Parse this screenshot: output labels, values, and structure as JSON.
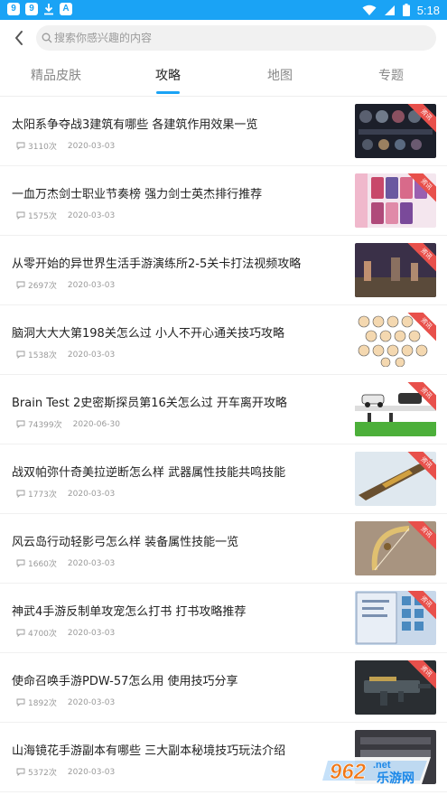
{
  "status_bar": {
    "time": "5:18",
    "left_icons": [
      "app-icon-1",
      "app-icon-2",
      "download-icon",
      "a-icon"
    ],
    "right_icons": [
      "wifi-icon",
      "signal-icon",
      "battery-icon"
    ]
  },
  "search": {
    "placeholder": "搜索你感兴趣的内容"
  },
  "tabs": [
    {
      "label": "精品皮肤",
      "active": false
    },
    {
      "label": "攻略",
      "active": true
    },
    {
      "label": "地图",
      "active": false
    },
    {
      "label": "专题",
      "active": false
    }
  ],
  "articles": [
    {
      "title": "太阳系争夺战3建筑有哪些 各建筑作用效果一览",
      "count": "3110次",
      "date": "2020-03-03",
      "badge": "资讯"
    },
    {
      "title": "一血万杰剑士职业节奏榜 强力剑士英杰排行推荐",
      "count": "1575次",
      "date": "2020-03-03",
      "badge": "资讯"
    },
    {
      "title": "从零开始的异世界生活手游演练所2-5关卡打法视频攻略",
      "count": "2697次",
      "date": "2020-03-03",
      "badge": "资讯"
    },
    {
      "title": "脑洞大大大第198关怎么过 小人不开心通关技巧攻略",
      "count": "1538次",
      "date": "2020-03-03",
      "badge": "资讯"
    },
    {
      "title": "Brain Test 2史密斯探员第16关怎么过 开车离开攻略",
      "count": "74399次",
      "date": "2020-06-30",
      "badge": "资讯"
    },
    {
      "title": "战双帕弥什奇美拉逆断怎么样 武器属性技能共鸣技能",
      "count": "1773次",
      "date": "2020-03-03",
      "badge": "资讯"
    },
    {
      "title": "风云岛行动轻影弓怎么样 装备属性技能一览",
      "count": "1660次",
      "date": "2020-03-03",
      "badge": "资讯"
    },
    {
      "title": "神武4手游反制单攻宠怎么打书 打书攻略推荐",
      "count": "4700次",
      "date": "2020-03-03",
      "badge": "资讯"
    },
    {
      "title": "使命召唤手游PDW-57怎么用 使用技巧分享",
      "count": "1892次",
      "date": "2020-03-03",
      "badge": "资讯"
    },
    {
      "title": "山海镜花手游副本有哪些 三大副本秘境技巧玩法介绍",
      "count": "5372次",
      "date": "2020-03-03",
      "badge": "资讯"
    }
  ],
  "watermark": {
    "number": "962",
    "suffix": ".net",
    "brand": "乐游网"
  },
  "colors": {
    "accent": "#1aa3f5",
    "badge": "#e8504b"
  }
}
